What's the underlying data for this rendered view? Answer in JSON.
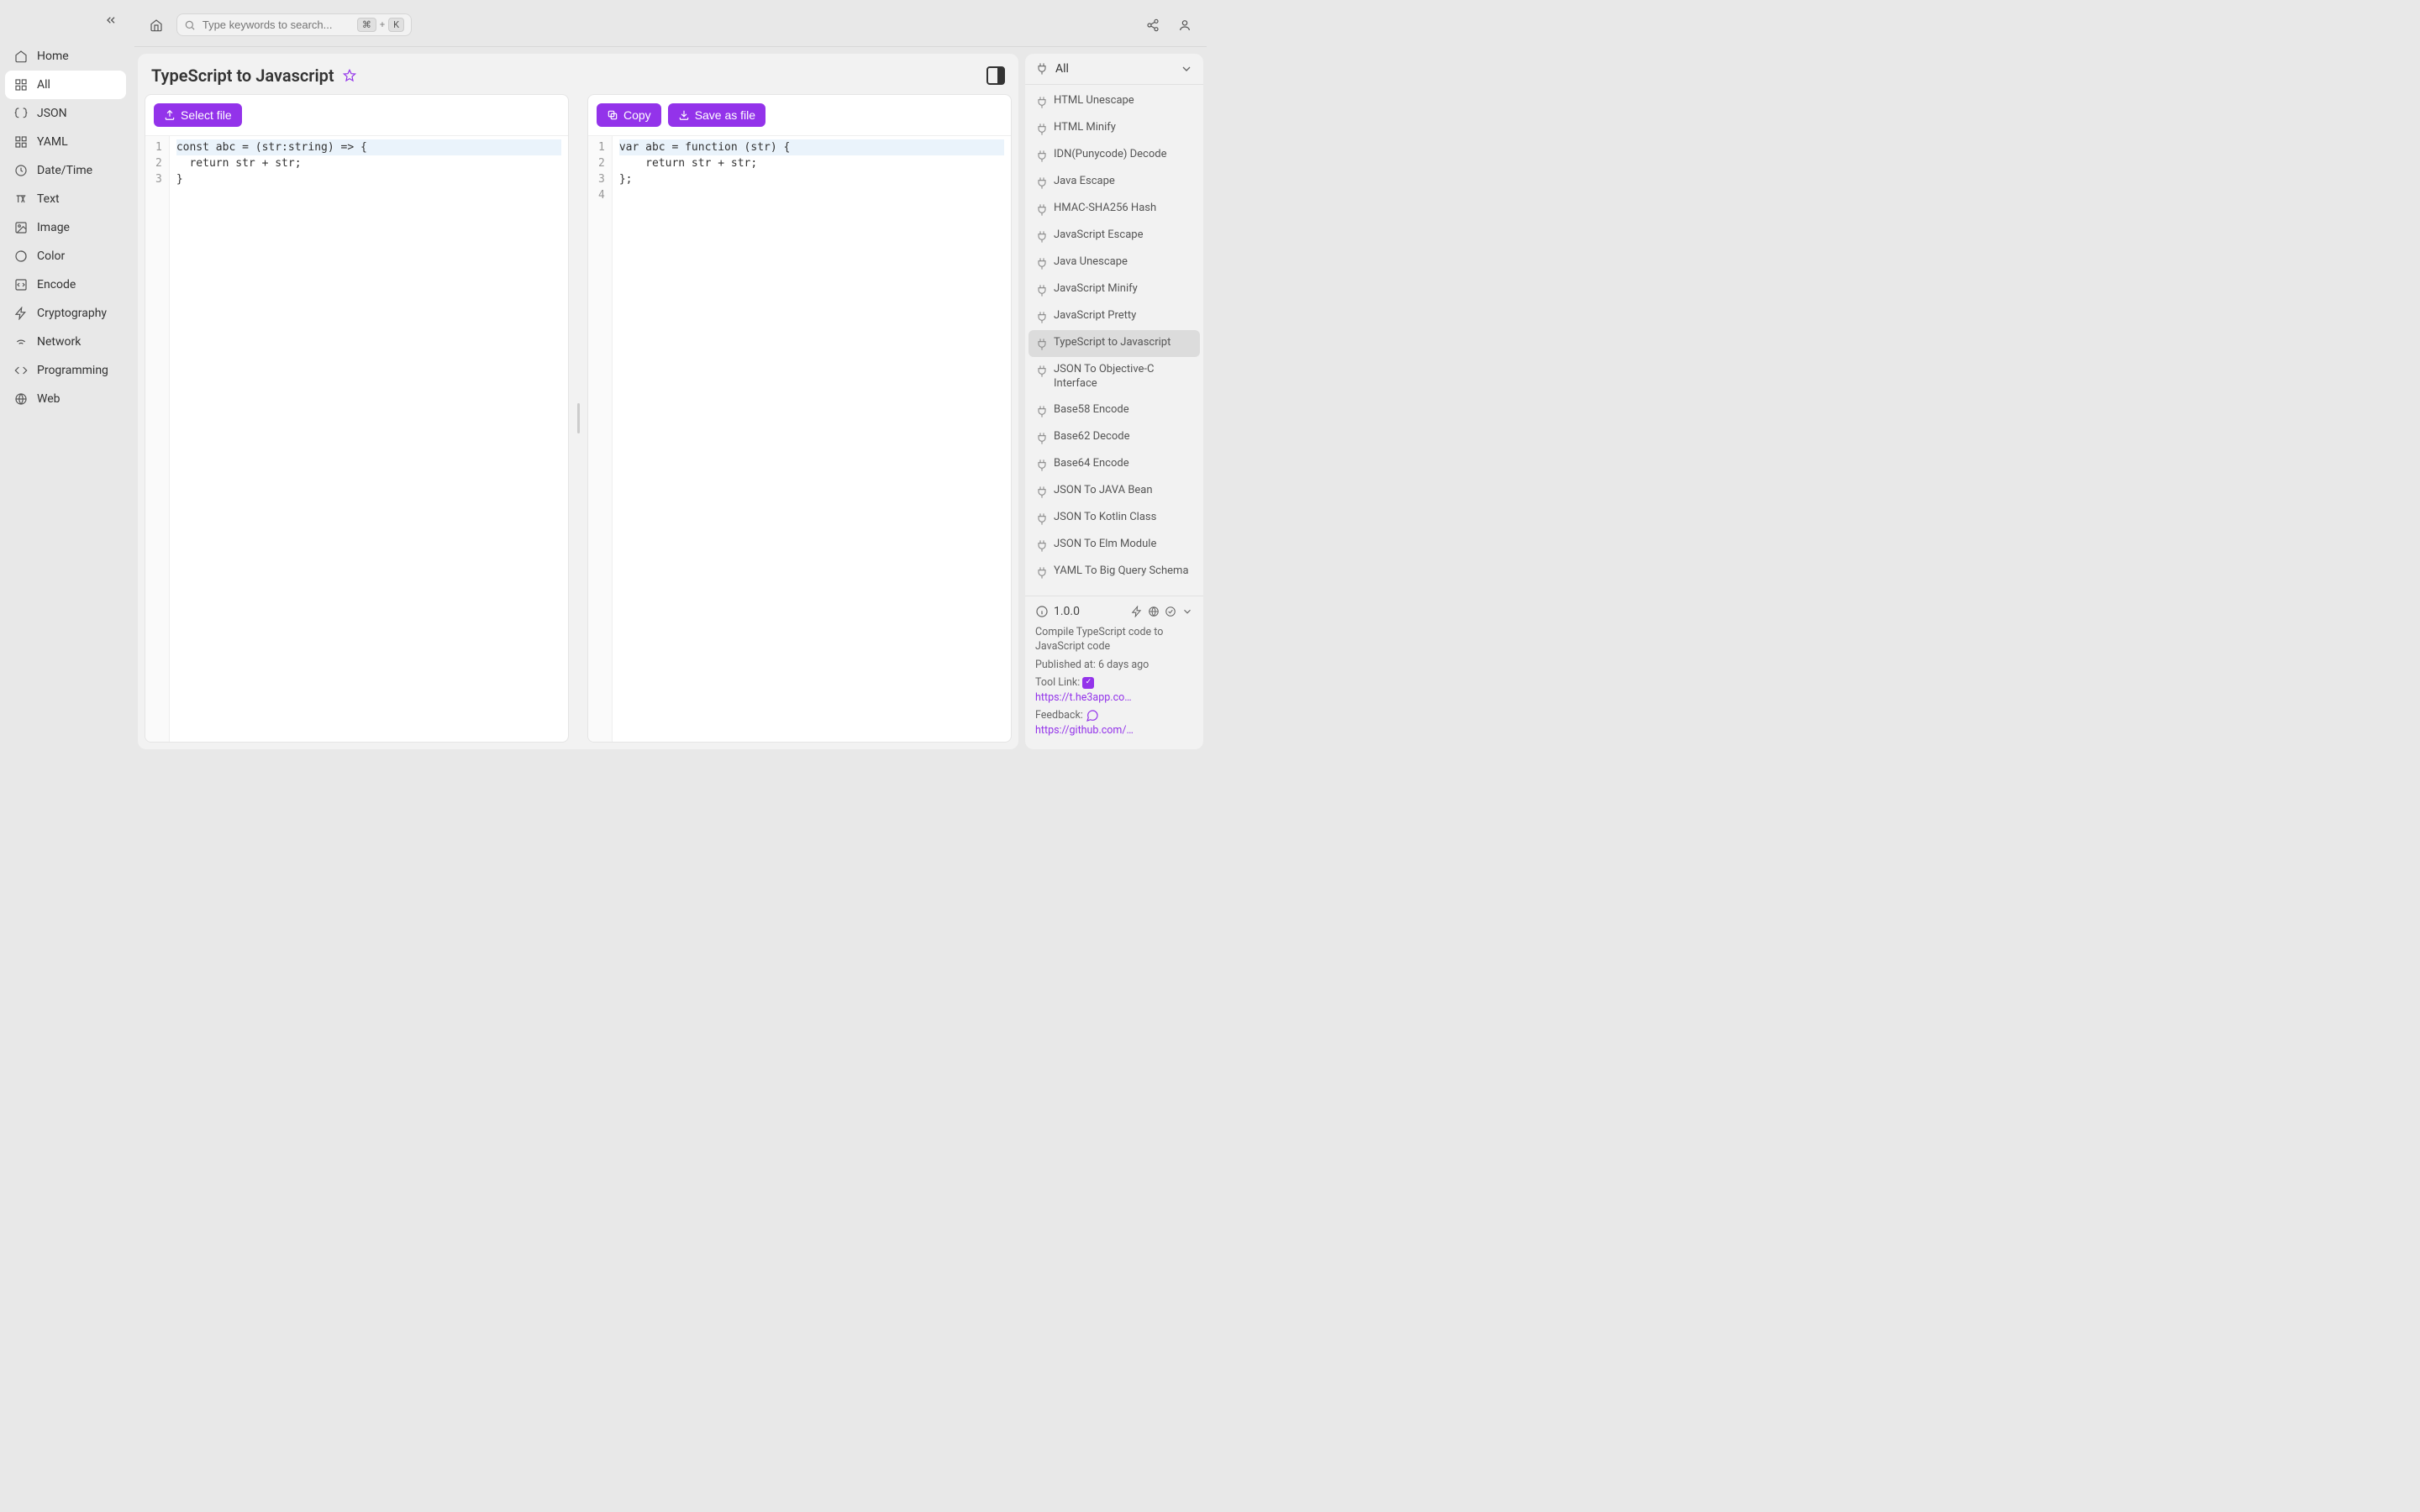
{
  "sidebar": {
    "items": [
      {
        "id": "home",
        "label": "Home"
      },
      {
        "id": "all",
        "label": "All"
      },
      {
        "id": "json",
        "label": "JSON"
      },
      {
        "id": "yaml",
        "label": "YAML"
      },
      {
        "id": "datetime",
        "label": "Date/Time"
      },
      {
        "id": "text",
        "label": "Text"
      },
      {
        "id": "image",
        "label": "Image"
      },
      {
        "id": "color",
        "label": "Color"
      },
      {
        "id": "encode",
        "label": "Encode"
      },
      {
        "id": "cryptography",
        "label": "Cryptography"
      },
      {
        "id": "network",
        "label": "Network"
      },
      {
        "id": "programming",
        "label": "Programming"
      },
      {
        "id": "web",
        "label": "Web"
      }
    ],
    "active": "all"
  },
  "search": {
    "placeholder": "Type keywords to search...",
    "shortcut_mod": "⌘",
    "shortcut_plus": "+",
    "shortcut_key": "K"
  },
  "page": {
    "title": "TypeScript to Javascript"
  },
  "buttons": {
    "select_file": "Select file",
    "copy": "Copy",
    "save_as_file": "Save as file"
  },
  "input_code": {
    "lines": [
      "const abc = (str:string) => {",
      "  return str + str;",
      "}"
    ]
  },
  "output_code": {
    "lines": [
      "var abc = function (str) {",
      "    return str + str;",
      "};",
      ""
    ]
  },
  "right": {
    "filter_label": "All",
    "tools": [
      "HTML Unescape",
      "HTML Minify",
      "IDN(Punycode) Decode",
      "Java Escape",
      "HMAC-SHA256 Hash",
      "JavaScript Escape",
      "Java Unescape",
      "JavaScript Minify",
      "JavaScript Pretty",
      "TypeScript to Javascript",
      "JSON To Objective-C Interface",
      "Base58 Encode",
      "Base62 Decode",
      "Base64 Encode",
      "JSON To JAVA Bean",
      "JSON To Kotlin Class",
      "JSON To Elm Module",
      "YAML To Big Query Schema"
    ],
    "active_tool": "TypeScript to Javascript"
  },
  "info": {
    "version": "1.0.0",
    "description": "Compile TypeScript code to JavaScript code",
    "published_label": "Published at:",
    "published_value": "6 days ago",
    "tool_link_label": "Tool Link:",
    "tool_link_value": "https://t.he3app.co…",
    "feedback_label": "Feedback:",
    "feedback_value": "https://github.com/…"
  }
}
